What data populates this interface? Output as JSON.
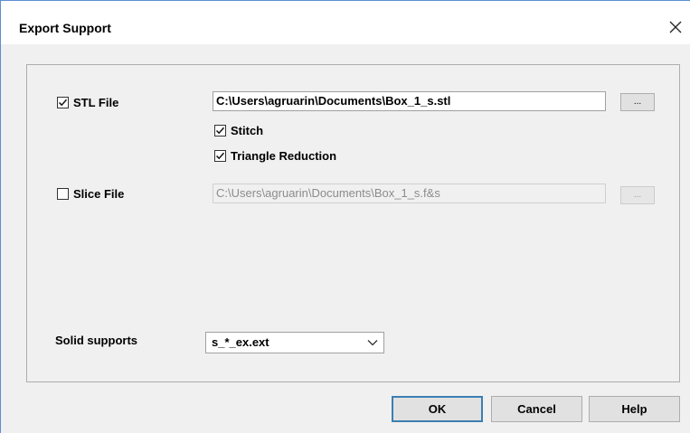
{
  "window": {
    "title": "Export Support",
    "close_glyph": "✕"
  },
  "stl": {
    "label": "STL File",
    "checked": true,
    "path": "C:\\Users\\agruarin\\Documents\\Box_1_s.stl",
    "browse_label": "...",
    "stitch_label": "Stitch",
    "stitch_checked": true,
    "triangle_label": "Triangle Reduction",
    "triangle_checked": true
  },
  "slice": {
    "label": "Slice File",
    "checked": false,
    "path": "C:\\Users\\agruarin\\Documents\\Box_1_s.f&s",
    "browse_label": "..."
  },
  "solid_supports": {
    "label": "Solid supports",
    "selected": "s_*_ex.ext"
  },
  "buttons": {
    "ok": "OK",
    "cancel": "Cancel",
    "help": "Help"
  },
  "colors": {
    "accent": "#3c7fb1",
    "dialog_bg": "#f0f0f0"
  }
}
